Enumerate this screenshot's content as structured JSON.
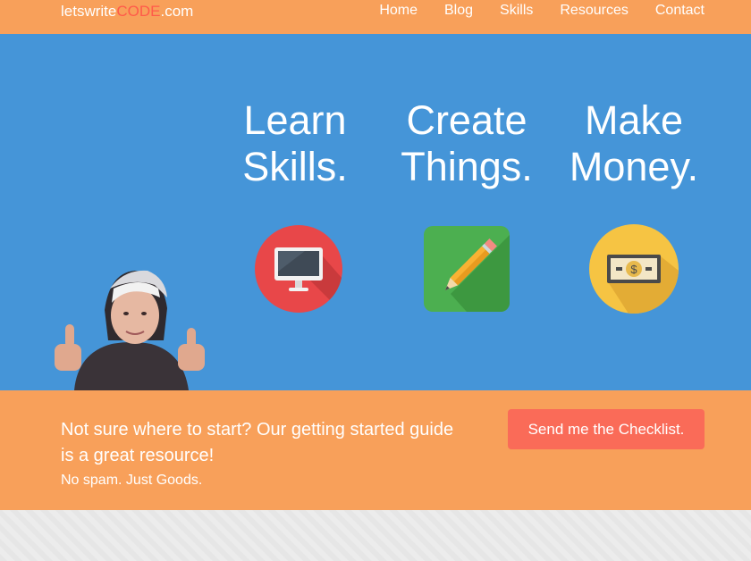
{
  "header": {
    "logo": {
      "part1": "letswrite",
      "part2": "CODE",
      "part3": ".com"
    },
    "nav": [
      "Home",
      "Blog",
      "Skills",
      "Resources",
      "Contact"
    ]
  },
  "hero": {
    "taglines": [
      {
        "line1": "Learn",
        "line2": "Skills."
      },
      {
        "line1": "Create",
        "line2": "Things."
      },
      {
        "line1": "Make",
        "line2": "Money."
      }
    ],
    "icons": [
      "monitor-icon",
      "pencil-icon",
      "money-icon"
    ]
  },
  "cta": {
    "message": "Not sure where to start? Our getting started guide is a great resource!",
    "subtext": "No spam. Just Goods.",
    "button": "Send me the Checklist."
  },
  "colors": {
    "accent": "#f8a05a",
    "hero_bg": "#4595d8",
    "button": "#fa6b58",
    "logo_code": "#ff5a4a"
  }
}
